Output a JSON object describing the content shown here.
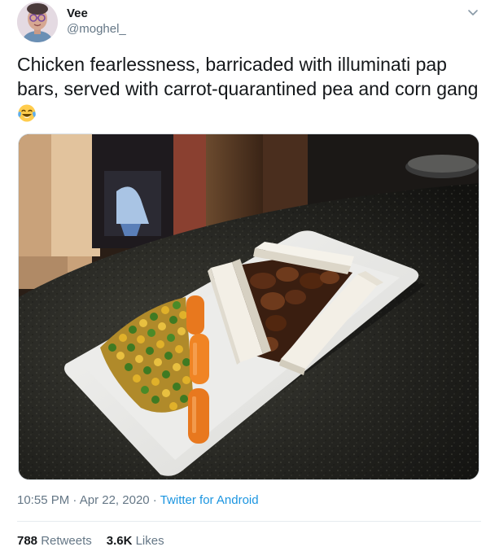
{
  "tweet": {
    "author": {
      "display_name": "Vee",
      "handle": "@moghel_",
      "avatar_icon": "avatar-illustration"
    },
    "menu_icon": "chevron-down-icon",
    "text_line_1": "Chicken fearlessness, barricaded with illuminati pap",
    "text_line_2": "bars, served with carrot-quarantined pea and corn gang",
    "emoji": "face-with-tears-of-joy-emoji",
    "media": {
      "kind": "photo",
      "subject": "plate of chicken stew with pap bars, peas, corn and carrots"
    },
    "time": "10:55 PM",
    "separator": " · ",
    "date": "Apr 22, 2020",
    "source": "Twitter for Android",
    "retweets_count": "788",
    "retweets_label": "Retweets",
    "likes_count": "3.6K",
    "likes_label": "Likes"
  },
  "colors": {
    "text": "#14171a",
    "secondary": "#657786",
    "link": "#1b95e0",
    "divider": "#e6ecf0"
  }
}
